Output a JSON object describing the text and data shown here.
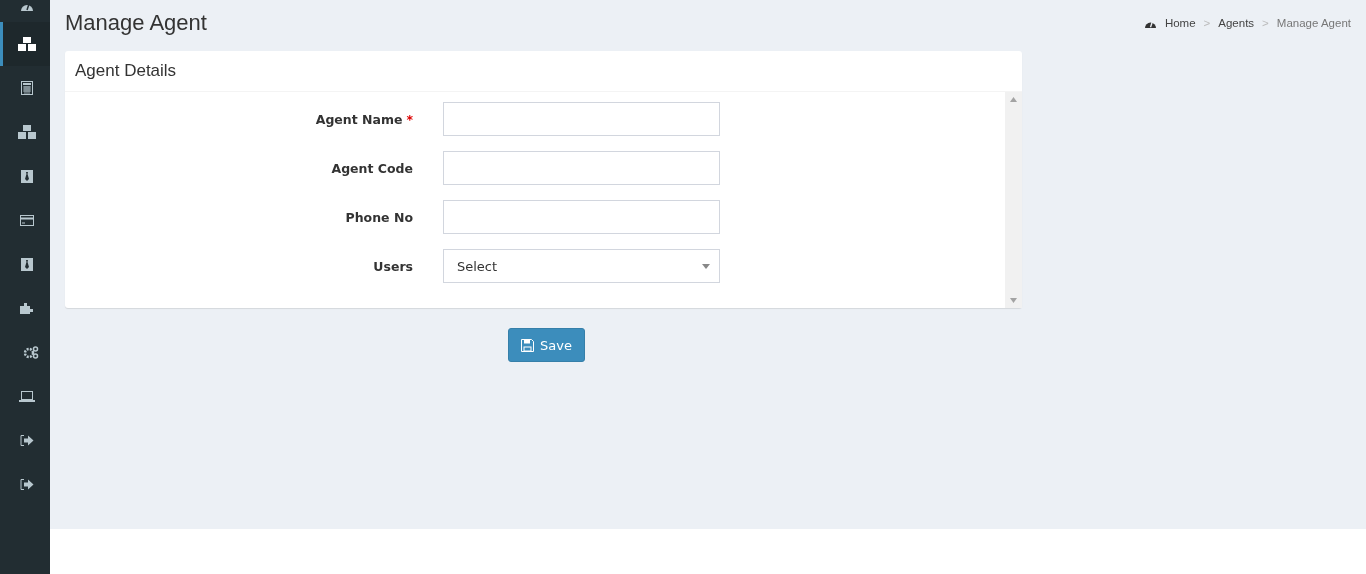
{
  "sidebar": {
    "items": [
      {
        "kind": "dashboard",
        "selected": false
      },
      {
        "kind": "cubes",
        "selected": true
      },
      {
        "kind": "calculator",
        "selected": false
      },
      {
        "kind": "cubes",
        "selected": false
      },
      {
        "kind": "tie",
        "selected": false
      },
      {
        "kind": "card",
        "selected": false
      },
      {
        "kind": "tie",
        "selected": false
      },
      {
        "kind": "puzzle",
        "selected": false
      },
      {
        "kind": "cogs",
        "selected": false
      },
      {
        "kind": "laptop",
        "selected": false
      },
      {
        "kind": "signout",
        "selected": false
      },
      {
        "kind": "signout",
        "selected": false
      }
    ]
  },
  "page_title": "Manage Agent",
  "breadcrumb": [
    {
      "label": "Home",
      "current": false
    },
    {
      "label": "Agents",
      "current": false
    },
    {
      "label": "Manage Agent",
      "current": true
    }
  ],
  "breadcrumb_separator": ">",
  "panel": {
    "title": "Agent Details",
    "fields": [
      {
        "label": "Agent Name",
        "required_mark": "*",
        "kind": "text"
      },
      {
        "label": "Agent Code",
        "kind": "text"
      },
      {
        "label": "Phone No",
        "kind": "text"
      },
      {
        "label": "Users",
        "kind": "select",
        "value": "Select"
      }
    ]
  },
  "save_button": "Save"
}
